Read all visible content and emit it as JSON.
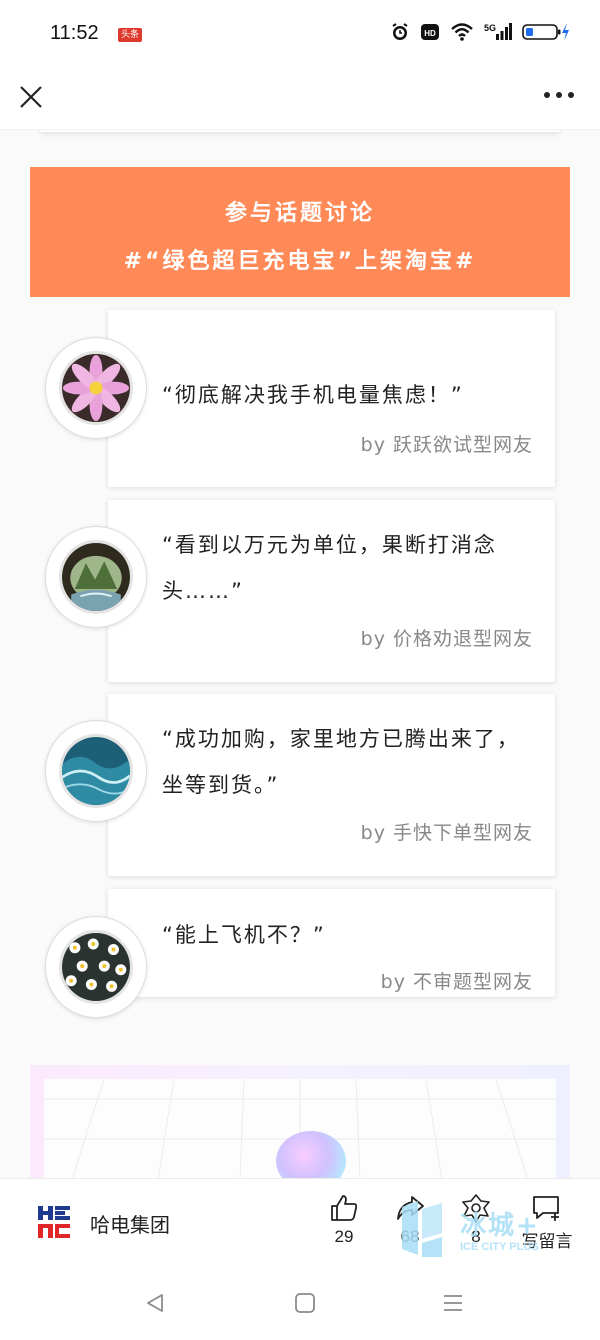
{
  "status_bar": {
    "time": "11:52",
    "badge": "头条",
    "network": "5G",
    "hd": "HD"
  },
  "nav": {
    "close_icon": "close-icon",
    "more_icon": "more-icon"
  },
  "banner": {
    "title": "参与话题讨论",
    "topic": "#“绿色超巨充电宝”上架淘宝#",
    "color": "#ff8a58"
  },
  "comments": [
    {
      "quote": "“彻底解决我手机电量焦虑！”",
      "by": "by 跃跃欲试型网友",
      "avatar": "pink-flower"
    },
    {
      "quote": "“看到以万元为单位，果断打消念头……”",
      "by": "by 价格劝退型网友",
      "avatar": "cave-landscape"
    },
    {
      "quote": "“成功加购，家里地方已腾出来了，坐等到货。”",
      "by": "by 手快下单型网友",
      "avatar": "ocean-wave"
    },
    {
      "quote": "“能上飞机不？”",
      "by": "by 不审题型网友",
      "avatar": "daisies"
    }
  ],
  "publisher": {
    "name": "哈电集团",
    "logo_colors": [
      "#1e3b8f",
      "#e02626"
    ]
  },
  "actions": {
    "like_count": "29",
    "share_count": "68",
    "collect_count": "8",
    "write_comment_label": "写留言"
  },
  "watermark": {
    "text": "冰城+",
    "sub": "ICE CITY PLUS"
  }
}
